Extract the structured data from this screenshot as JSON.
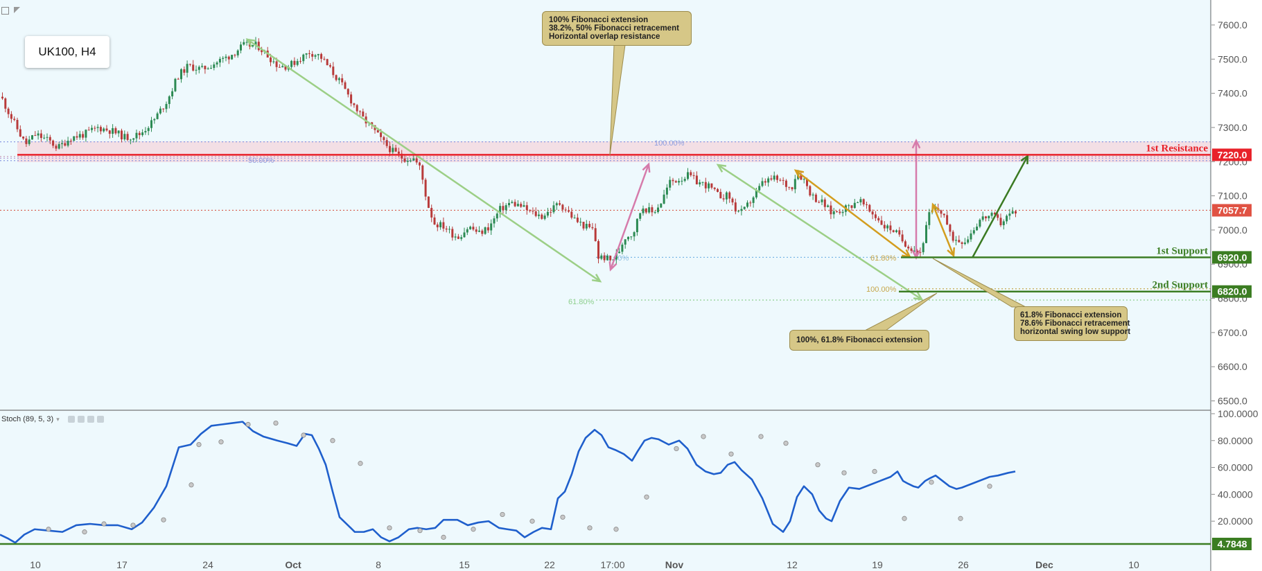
{
  "toolbar": {
    "icons": [
      "collapse-icon",
      "flag-icon"
    ]
  },
  "title": "UK100, H4",
  "indicator": {
    "label": "Stoch (89, 5, 3)",
    "icons": [
      "eye-icon",
      "gear-icon",
      "plus-icon",
      "close-icon"
    ]
  },
  "callouts": [
    {
      "lines": [
        "100% Fibonacci extension",
        "38.2%, 50% Fibonacci retracement",
        "Horizontal overlap resistance"
      ]
    },
    {
      "lines": [
        "100%, 61.8% Fibonacci extension"
      ]
    },
    {
      "lines": [
        "61.8% Fibonacci extension",
        "78.6% Fibonacci retracement",
        "horizontal swing low support"
      ]
    }
  ],
  "levels": [
    {
      "label": "1st Resistance",
      "value": "7220.0",
      "color": "#e8222a"
    },
    {
      "label": "1st Support",
      "value": "6920.0",
      "color": "#3b7d22"
    },
    {
      "label": "2nd Support",
      "value": "6820.0",
      "color": "#3b7d22"
    }
  ],
  "current_price": {
    "value": "7057.7",
    "color": "#e05243"
  },
  "fib_labels": [
    "50.00%",
    "100.00%",
    "78.60%",
    "61.80%",
    "61.80%",
    "100.00%"
  ],
  "stoch_level": "4.7848",
  "chart_data": [
    {
      "type": "candlestick",
      "title": "UK100, H4",
      "x_ticks": [
        "10",
        "17",
        "24",
        "Oct",
        "8",
        "15",
        "22",
        "17:00",
        "Nov",
        "12",
        "19",
        "26",
        "Dec",
        "10"
      ],
      "y_ticks": [
        "7600.0",
        "7500.0",
        "7400.0",
        "7300.0",
        "7200.0",
        "7100.0",
        "7000.0",
        "6900.0",
        "6800.0",
        "6700.0",
        "6600.0",
        "6500.0"
      ],
      "ylim": [
        6475,
        7650
      ],
      "price_path": [
        [
          0,
          7390
        ],
        [
          12,
          7340
        ],
        [
          25,
          7290
        ],
        [
          35,
          7250
        ],
        [
          50,
          7280
        ],
        [
          70,
          7260
        ],
        [
          82,
          7240
        ],
        [
          100,
          7270
        ],
        [
          120,
          7280
        ],
        [
          140,
          7300
        ],
        [
          160,
          7290
        ],
        [
          180,
          7270
        ],
        [
          200,
          7280
        ],
        [
          220,
          7320
        ],
        [
          240,
          7380
        ],
        [
          255,
          7450
        ],
        [
          270,
          7480
        ],
        [
          290,
          7470
        ],
        [
          310,
          7490
        ],
        [
          330,
          7510
        ],
        [
          350,
          7540
        ],
        [
          370,
          7540
        ],
        [
          385,
          7510
        ],
        [
          400,
          7480
        ],
        [
          415,
          7480
        ],
        [
          430,
          7500
        ],
        [
          445,
          7520
        ],
        [
          460,
          7510
        ],
        [
          475,
          7470
        ],
        [
          490,
          7430
        ],
        [
          505,
          7380
        ],
        [
          520,
          7330
        ],
        [
          535,
          7300
        ],
        [
          550,
          7260
        ],
        [
          565,
          7230
        ],
        [
          580,
          7210
        ],
        [
          595,
          7210
        ],
        [
          605,
          7180
        ],
        [
          615,
          7080
        ],
        [
          625,
          7020
        ],
        [
          640,
          7010
        ],
        [
          650,
          6990
        ],
        [
          660,
          6980
        ],
        [
          675,
          7010
        ],
        [
          690,
          6990
        ],
        [
          705,
          7010
        ],
        [
          720,
          7060
        ],
        [
          735,
          7080
        ],
        [
          750,
          7070
        ],
        [
          765,
          7050
        ],
        [
          780,
          7040
        ],
        [
          795,
          7060
        ],
        [
          805,
          7080
        ],
        [
          815,
          7060
        ],
        [
          828,
          7030
        ],
        [
          843,
          7010
        ],
        [
          855,
          7000
        ],
        [
          862,
          6920
        ],
        [
          870,
          6920
        ],
        [
          880,
          6910
        ],
        [
          890,
          6930
        ],
        [
          900,
          6980
        ],
        [
          912,
          6990
        ],
        [
          925,
          7070
        ],
        [
          940,
          7050
        ],
        [
          952,
          7080
        ],
        [
          965,
          7140
        ],
        [
          980,
          7150
        ],
        [
          992,
          7160
        ],
        [
          1005,
          7140
        ],
        [
          1020,
          7130
        ],
        [
          1035,
          7100
        ],
        [
          1050,
          7100
        ],
        [
          1060,
          7060
        ],
        [
          1070,
          7050
        ],
        [
          1083,
          7090
        ],
        [
          1100,
          7140
        ],
        [
          1115,
          7150
        ],
        [
          1128,
          7140
        ],
        [
          1140,
          7120
        ],
        [
          1148,
          7170
        ],
        [
          1158,
          7150
        ],
        [
          1170,
          7100
        ],
        [
          1185,
          7080
        ],
        [
          1198,
          7050
        ],
        [
          1212,
          7060
        ],
        [
          1225,
          7070
        ],
        [
          1238,
          7090
        ],
        [
          1250,
          7060
        ],
        [
          1262,
          7040
        ],
        [
          1275,
          7010
        ],
        [
          1288,
          7000
        ],
        [
          1300,
          6970
        ],
        [
          1312,
          6950
        ],
        [
          1320,
          6940
        ],
        [
          1327,
          6935
        ],
        [
          1333,
          6990
        ],
        [
          1340,
          7050
        ],
        [
          1350,
          7060
        ],
        [
          1360,
          7050
        ],
        [
          1370,
          6980
        ],
        [
          1382,
          6970
        ],
        [
          1392,
          6970
        ],
        [
          1402,
          7000
        ],
        [
          1412,
          7030
        ],
        [
          1422,
          7040
        ],
        [
          1432,
          7040
        ],
        [
          1442,
          7020
        ],
        [
          1452,
          7040
        ],
        [
          1462,
          7055
        ],
        [
          1470,
          7058
        ]
      ]
    },
    {
      "type": "line",
      "title": "Stoch (89, 5, 3)",
      "y_ticks": [
        "100.0000",
        "80.0000",
        "60.0000",
        "40.0000",
        "20.0000"
      ],
      "ylim": [
        0,
        100
      ],
      "x": [
        0,
        12,
        22,
        35,
        50,
        70,
        90,
        110,
        130,
        150,
        170,
        190,
        205,
        222,
        240,
        258,
        275,
        290,
        305,
        320,
        335,
        350,
        365,
        380,
        400,
        415,
        428,
        440,
        450,
        460,
        470,
        480,
        490,
        502,
        512,
        525,
        538,
        550,
        562,
        575,
        590,
        602,
        615,
        628,
        640,
        660,
        675,
        690,
        705,
        720,
        732,
        745,
        757,
        770,
        782,
        795,
        805,
        815,
        825,
        835,
        845,
        858,
        868,
        878,
        888,
        900,
        912,
        920,
        930,
        940,
        950,
        965,
        980,
        992,
        1005,
        1018,
        1030,
        1040,
        1050,
        1060,
        1070,
        1085,
        1100,
        1115,
        1130,
        1140,
        1150,
        1160,
        1172,
        1182,
        1192,
        1200,
        1212,
        1225,
        1240,
        1255,
        1270,
        1285,
        1295,
        1303,
        1310,
        1318,
        1325,
        1335,
        1342,
        1350,
        1360,
        1370,
        1380,
        1388,
        1398,
        1408,
        1418,
        1428,
        1440,
        1455,
        1465
      ],
      "values": [
        10,
        7,
        4,
        10,
        14,
        13,
        12,
        17,
        18,
        17,
        17,
        14,
        19,
        30,
        46,
        75,
        77,
        85,
        91,
        92,
        93,
        94,
        87,
        83,
        80,
        78,
        76,
        85,
        84,
        74,
        62,
        42,
        23,
        17,
        12,
        12,
        14,
        8,
        5,
        8,
        14,
        15,
        14,
        15,
        21,
        21,
        17,
        19,
        20,
        15,
        14,
        13,
        8,
        12,
        15,
        14,
        37,
        42,
        55,
        72,
        82,
        88,
        84,
        75,
        73,
        70,
        65,
        72,
        80,
        82,
        81,
        77,
        80,
        74,
        62,
        57,
        55,
        56,
        62,
        64,
        58,
        51,
        37,
        18,
        12,
        20,
        38,
        46,
        40,
        28,
        22,
        20,
        35,
        45,
        44,
        47,
        50,
        53,
        57,
        50,
        48,
        46,
        45,
        50,
        52,
        54,
        50,
        46,
        44,
        45,
        47,
        49,
        51,
        53,
        54,
        56,
        57
      ]
    }
  ]
}
